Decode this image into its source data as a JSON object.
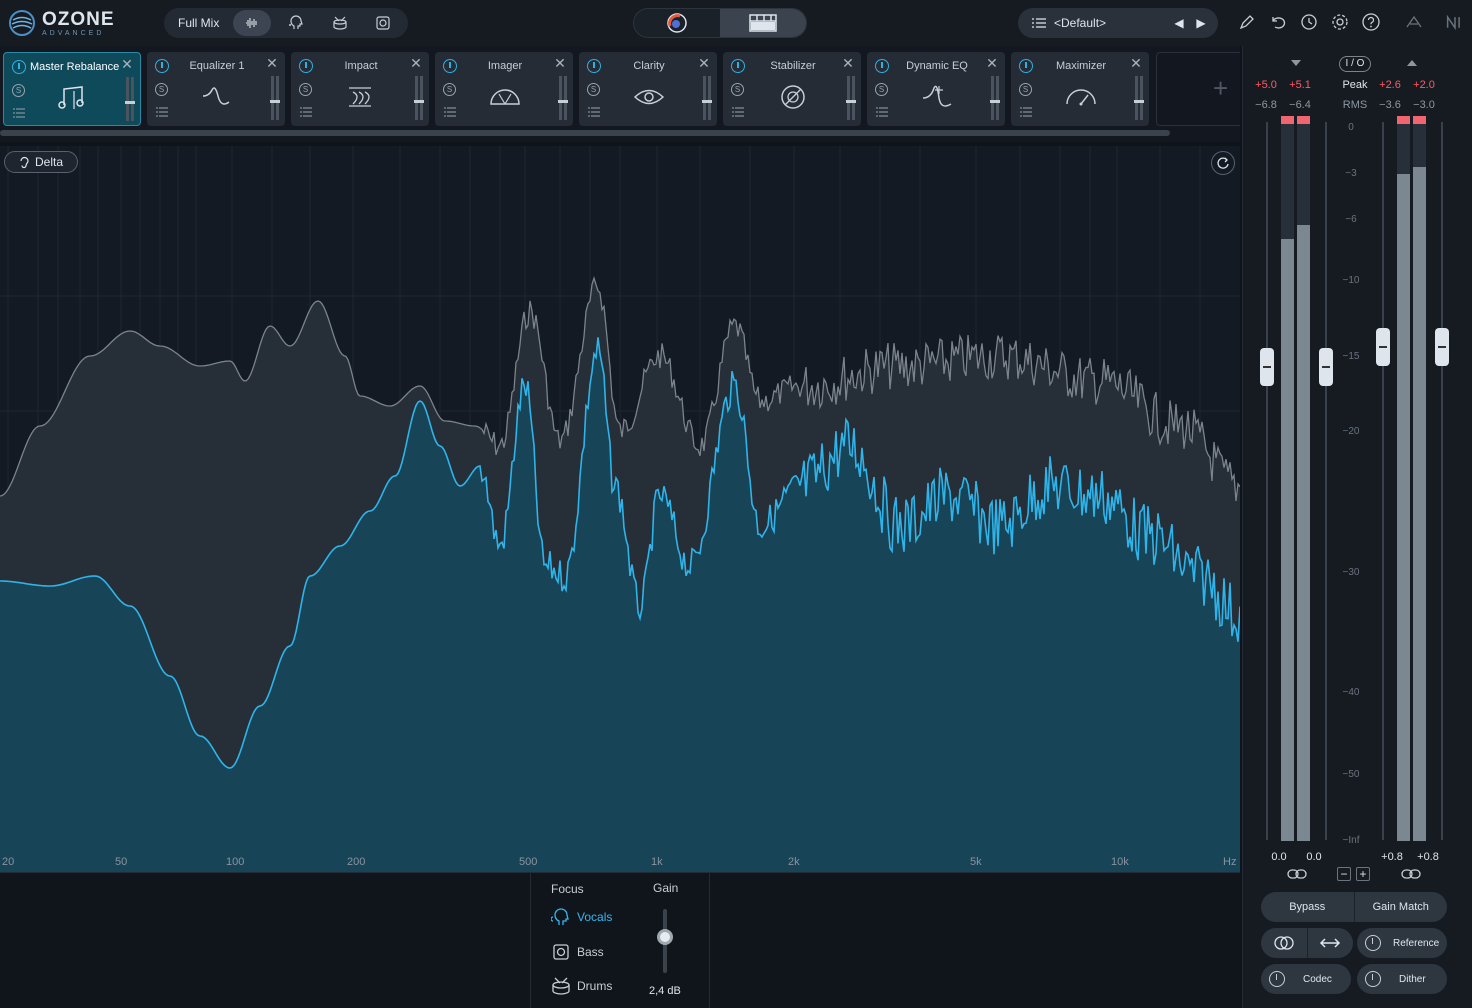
{
  "app": {
    "logo_title": "OZONE",
    "logo_sub": "ADVANCED",
    "mode_label": "Full Mix",
    "preset_name": "<Default>"
  },
  "modules": [
    {
      "name": "Master Rebalance",
      "icon": "music-note-icon",
      "active": true
    },
    {
      "name": "Equalizer 1",
      "icon": "eq-curve-icon",
      "active": false
    },
    {
      "name": "Impact",
      "icon": "impact-icon",
      "active": false
    },
    {
      "name": "Imager",
      "icon": "imager-icon",
      "active": false
    },
    {
      "name": "Clarity",
      "icon": "eye-icon",
      "active": false
    },
    {
      "name": "Stabilizer",
      "icon": "stabilizer-icon",
      "active": false
    },
    {
      "name": "Dynamic EQ",
      "icon": "dynamic-eq-icon",
      "active": false
    },
    {
      "name": "Maximizer",
      "icon": "gauge-icon",
      "active": false
    }
  ],
  "spectrum": {
    "delta_label": "Delta",
    "freq_labels": [
      "20",
      "50",
      "100",
      "200",
      "500",
      "1k",
      "2k",
      "5k",
      "10k",
      "Hz"
    ]
  },
  "focus": {
    "title": "Focus",
    "gain_title": "Gain",
    "items": [
      {
        "label": "Vocals",
        "active": true
      },
      {
        "label": "Bass",
        "active": false
      },
      {
        "label": "Drums",
        "active": false
      }
    ],
    "gain_value": "2,4 dB"
  },
  "meters": {
    "io_label": "I / O",
    "peak_label": "Peak",
    "rms_label": "RMS",
    "in_peak": [
      "+5.0",
      "+5.1"
    ],
    "in_rms": [
      "−6.8",
      "−6.4"
    ],
    "out_peak": [
      "+2.6",
      "+2.0"
    ],
    "out_rms": [
      "−3.6",
      "−3.0"
    ],
    "scale": [
      "0",
      "−3",
      "−6",
      "−10",
      "−15",
      "−20",
      "−30",
      "−40",
      "−50",
      "−Inf"
    ],
    "in_gain": [
      "0.0",
      "0.0"
    ],
    "out_gain": [
      "+0.8",
      "+0.8"
    ],
    "in_level": [
      0.83,
      0.85
    ],
    "out_level": [
      0.92,
      0.93
    ],
    "bypass_label": "Bypass",
    "gain_match_label": "Gain Match",
    "reference_label": "Reference",
    "codec_label": "Codec",
    "dither_label": "Dither"
  },
  "colors": {
    "accent": "#35b7ee",
    "peak_red": "#f26470"
  }
}
